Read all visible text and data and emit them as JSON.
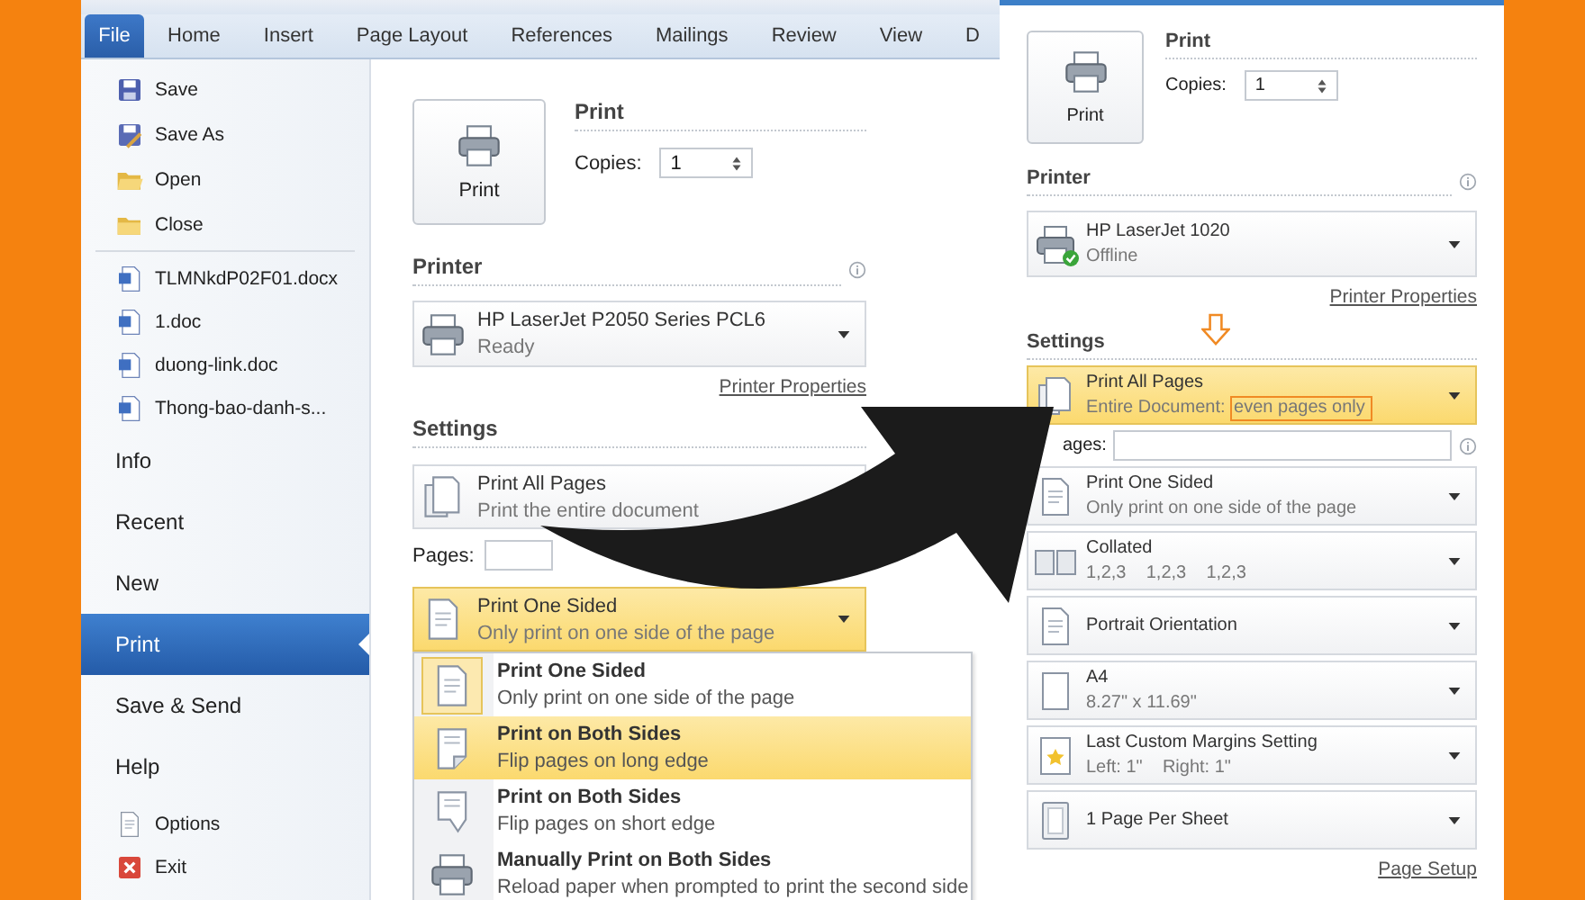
{
  "left_screenshot": {
    "ribbon_tabs": [
      {
        "label": "File",
        "selected": true
      },
      {
        "label": "Home",
        "selected": false
      },
      {
        "label": "Insert",
        "selected": false
      },
      {
        "label": "Page Layout",
        "selected": false
      },
      {
        "label": "References",
        "selected": false
      },
      {
        "label": "Mailings",
        "selected": false
      },
      {
        "label": "Review",
        "selected": false
      },
      {
        "label": "View",
        "selected": false
      },
      {
        "label": "D",
        "selected": false
      }
    ],
    "nav": {
      "commands": [
        {
          "label": "Save",
          "kind": "save"
        },
        {
          "label": "Save As",
          "kind": "save_as"
        },
        {
          "label": "Open",
          "kind": "open"
        },
        {
          "label": "Close",
          "kind": "close"
        }
      ],
      "recent_files": [
        {
          "label": "TLMNkdP02F01.docx",
          "kind": "doc"
        },
        {
          "label": "1.doc",
          "kind": "doc"
        },
        {
          "label": "duong-link.doc",
          "kind": "doc"
        },
        {
          "label": "Thong-bao-danh-s...",
          "kind": "doc"
        }
      ],
      "sections": [
        {
          "label": "Info",
          "selected": false
        },
        {
          "label": "Recent",
          "selected": false
        },
        {
          "label": "New",
          "selected": false
        },
        {
          "label": "Print",
          "selected": true
        },
        {
          "label": "Save & Send",
          "selected": false
        },
        {
          "label": "Help",
          "selected": false
        }
      ],
      "footer": [
        {
          "label": "Options",
          "kind": "options"
        },
        {
          "label": "Exit",
          "kind": "exit"
        }
      ]
    },
    "print": {
      "button": "Print",
      "heading": "Print",
      "copies_label": "Copies:",
      "copies": "1"
    },
    "printer": {
      "heading": "Printer",
      "name": "HP LaserJet P2050 Series PCL6",
      "status": "Ready",
      "check_badge": false,
      "properties_link": "Printer Properties"
    },
    "settings": {
      "heading": "Settings",
      "pages_label": "Pages:",
      "rows_before_pages": [
        {
          "kind": "pages",
          "title": "Print All Pages",
          "subtitle": "Print the entire document",
          "highlighted": false
        }
      ],
      "rows": [
        {
          "kind": "one_sided",
          "title": "Print One Sided",
          "subtitle": "Only print on one side of the page",
          "highlighted": true
        }
      ]
    },
    "duplex_menu": [
      {
        "kind": "one_sided",
        "title": "Print One Sided",
        "subtitle": "Only print on one side of the page",
        "selected": true,
        "hovered": false
      },
      {
        "kind": "both_long",
        "title": "Print on Both Sides",
        "subtitle": "Flip pages on long edge",
        "selected": false,
        "hovered": true
      },
      {
        "kind": "both_short",
        "title": "Print on Both Sides",
        "subtitle": "Flip pages on short edge",
        "selected": false,
        "hovered": false
      },
      {
        "kind": "manual",
        "title": "Manually Print on Both Sides",
        "subtitle": "Reload paper when prompted to print the second side",
        "selected": false,
        "hovered": false
      }
    ]
  },
  "right_screenshot": {
    "print": {
      "button": "Print",
      "heading": "Print",
      "copies_label": "Copies:",
      "copies": "1"
    },
    "printer": {
      "heading": "Printer",
      "name": "HP LaserJet 1020",
      "status": "Offline",
      "check_badge": true,
      "properties_link": "Printer Properties"
    },
    "settings": {
      "heading": "Settings",
      "pages_label": "ages:",
      "rows_before_pages": [
        {
          "kind": "pages",
          "title": "Print All Pages",
          "subtitle": "Entire Document:",
          "boxed_note": "even pages only",
          "highlighted": true
        }
      ],
      "rows": [
        {
          "kind": "one_sided",
          "title": "Print One Sided",
          "subtitle": "Only print on one side of the page",
          "highlighted": false
        },
        {
          "kind": "collated",
          "title": "Collated",
          "subtitle": "1,2,3    1,2,3    1,2,3",
          "highlighted": false
        },
        {
          "kind": "portrait",
          "title": "Portrait Orientation",
          "highlighted": false
        },
        {
          "kind": "a4",
          "title": "A4",
          "subtitle": "8.27\" x 11.69\"",
          "highlighted": false
        },
        {
          "kind": "margins",
          "title": "Last Custom Margins Setting",
          "subtitle": "Left: 1\"    Right: 1\"",
          "highlighted": false
        },
        {
          "kind": "per_sheet",
          "title": "1 Page Per Sheet",
          "highlighted": false
        }
      ],
      "page_setup_link": "Page Setup"
    }
  }
}
